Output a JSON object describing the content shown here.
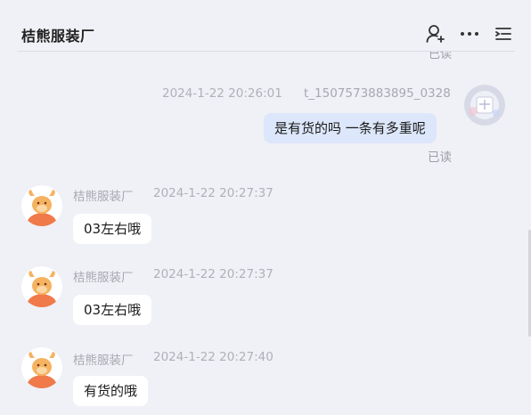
{
  "header": {
    "title": "桔熊服装厂",
    "icons": [
      "add-user-icon",
      "more-icon",
      "menu-list-icon"
    ]
  },
  "top_read_label": "已读",
  "messages": [
    {
      "side": "me",
      "time": "2024-1-22 20:26:01",
      "sender": "t_1507573883895_0328",
      "text": "是有货的吗 一条有多重呢",
      "status": "已读"
    },
    {
      "side": "other",
      "sender": "桔熊服装厂",
      "time": "2024-1-22 20:27:37",
      "text": "03左右哦"
    },
    {
      "side": "other",
      "sender": "桔熊服装厂",
      "time": "2024-1-22 20:27:37",
      "text": "03左右哦"
    },
    {
      "side": "other",
      "sender": "桔熊服装厂",
      "time": "2024-1-22 20:27:40",
      "text": "有货的哦"
    }
  ],
  "colors": {
    "background": "#f0f1f6",
    "my_bubble": "#dde7fb",
    "other_bubble": "#ffffff",
    "meta_text": "#a8a8b0",
    "avatar_orange": "#f07a4a"
  }
}
